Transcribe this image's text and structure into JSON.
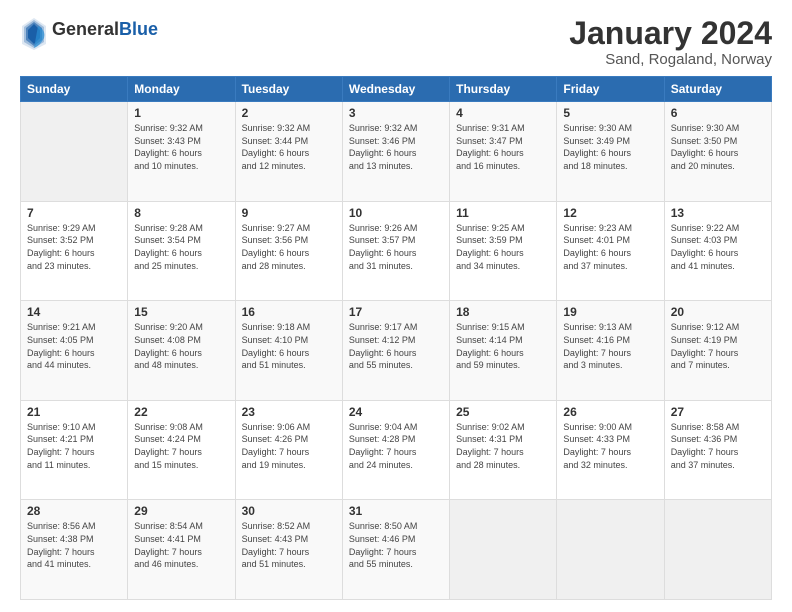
{
  "header": {
    "logo_general": "General",
    "logo_blue": "Blue",
    "title": "January 2024",
    "subtitle": "Sand, Rogaland, Norway"
  },
  "calendar": {
    "days_of_week": [
      "Sunday",
      "Monday",
      "Tuesday",
      "Wednesday",
      "Thursday",
      "Friday",
      "Saturday"
    ],
    "weeks": [
      [
        {
          "day": "",
          "info": ""
        },
        {
          "day": "1",
          "info": "Sunrise: 9:32 AM\nSunset: 3:43 PM\nDaylight: 6 hours\nand 10 minutes."
        },
        {
          "day": "2",
          "info": "Sunrise: 9:32 AM\nSunset: 3:44 PM\nDaylight: 6 hours\nand 12 minutes."
        },
        {
          "day": "3",
          "info": "Sunrise: 9:32 AM\nSunset: 3:46 PM\nDaylight: 6 hours\nand 13 minutes."
        },
        {
          "day": "4",
          "info": "Sunrise: 9:31 AM\nSunset: 3:47 PM\nDaylight: 6 hours\nand 16 minutes."
        },
        {
          "day": "5",
          "info": "Sunrise: 9:30 AM\nSunset: 3:49 PM\nDaylight: 6 hours\nand 18 minutes."
        },
        {
          "day": "6",
          "info": "Sunrise: 9:30 AM\nSunset: 3:50 PM\nDaylight: 6 hours\nand 20 minutes."
        }
      ],
      [
        {
          "day": "7",
          "info": "Sunrise: 9:29 AM\nSunset: 3:52 PM\nDaylight: 6 hours\nand 23 minutes."
        },
        {
          "day": "8",
          "info": "Sunrise: 9:28 AM\nSunset: 3:54 PM\nDaylight: 6 hours\nand 25 minutes."
        },
        {
          "day": "9",
          "info": "Sunrise: 9:27 AM\nSunset: 3:56 PM\nDaylight: 6 hours\nand 28 minutes."
        },
        {
          "day": "10",
          "info": "Sunrise: 9:26 AM\nSunset: 3:57 PM\nDaylight: 6 hours\nand 31 minutes."
        },
        {
          "day": "11",
          "info": "Sunrise: 9:25 AM\nSunset: 3:59 PM\nDaylight: 6 hours\nand 34 minutes."
        },
        {
          "day": "12",
          "info": "Sunrise: 9:23 AM\nSunset: 4:01 PM\nDaylight: 6 hours\nand 37 minutes."
        },
        {
          "day": "13",
          "info": "Sunrise: 9:22 AM\nSunset: 4:03 PM\nDaylight: 6 hours\nand 41 minutes."
        }
      ],
      [
        {
          "day": "14",
          "info": "Sunrise: 9:21 AM\nSunset: 4:05 PM\nDaylight: 6 hours\nand 44 minutes."
        },
        {
          "day": "15",
          "info": "Sunrise: 9:20 AM\nSunset: 4:08 PM\nDaylight: 6 hours\nand 48 minutes."
        },
        {
          "day": "16",
          "info": "Sunrise: 9:18 AM\nSunset: 4:10 PM\nDaylight: 6 hours\nand 51 minutes."
        },
        {
          "day": "17",
          "info": "Sunrise: 9:17 AM\nSunset: 4:12 PM\nDaylight: 6 hours\nand 55 minutes."
        },
        {
          "day": "18",
          "info": "Sunrise: 9:15 AM\nSunset: 4:14 PM\nDaylight: 6 hours\nand 59 minutes."
        },
        {
          "day": "19",
          "info": "Sunrise: 9:13 AM\nSunset: 4:16 PM\nDaylight: 7 hours\nand 3 minutes."
        },
        {
          "day": "20",
          "info": "Sunrise: 9:12 AM\nSunset: 4:19 PM\nDaylight: 7 hours\nand 7 minutes."
        }
      ],
      [
        {
          "day": "21",
          "info": "Sunrise: 9:10 AM\nSunset: 4:21 PM\nDaylight: 7 hours\nand 11 minutes."
        },
        {
          "day": "22",
          "info": "Sunrise: 9:08 AM\nSunset: 4:24 PM\nDaylight: 7 hours\nand 15 minutes."
        },
        {
          "day": "23",
          "info": "Sunrise: 9:06 AM\nSunset: 4:26 PM\nDaylight: 7 hours\nand 19 minutes."
        },
        {
          "day": "24",
          "info": "Sunrise: 9:04 AM\nSunset: 4:28 PM\nDaylight: 7 hours\nand 24 minutes."
        },
        {
          "day": "25",
          "info": "Sunrise: 9:02 AM\nSunset: 4:31 PM\nDaylight: 7 hours\nand 28 minutes."
        },
        {
          "day": "26",
          "info": "Sunrise: 9:00 AM\nSunset: 4:33 PM\nDaylight: 7 hours\nand 32 minutes."
        },
        {
          "day": "27",
          "info": "Sunrise: 8:58 AM\nSunset: 4:36 PM\nDaylight: 7 hours\nand 37 minutes."
        }
      ],
      [
        {
          "day": "28",
          "info": "Sunrise: 8:56 AM\nSunset: 4:38 PM\nDaylight: 7 hours\nand 41 minutes."
        },
        {
          "day": "29",
          "info": "Sunrise: 8:54 AM\nSunset: 4:41 PM\nDaylight: 7 hours\nand 46 minutes."
        },
        {
          "day": "30",
          "info": "Sunrise: 8:52 AM\nSunset: 4:43 PM\nDaylight: 7 hours\nand 51 minutes."
        },
        {
          "day": "31",
          "info": "Sunrise: 8:50 AM\nSunset: 4:46 PM\nDaylight: 7 hours\nand 55 minutes."
        },
        {
          "day": "",
          "info": ""
        },
        {
          "day": "",
          "info": ""
        },
        {
          "day": "",
          "info": ""
        }
      ]
    ]
  }
}
